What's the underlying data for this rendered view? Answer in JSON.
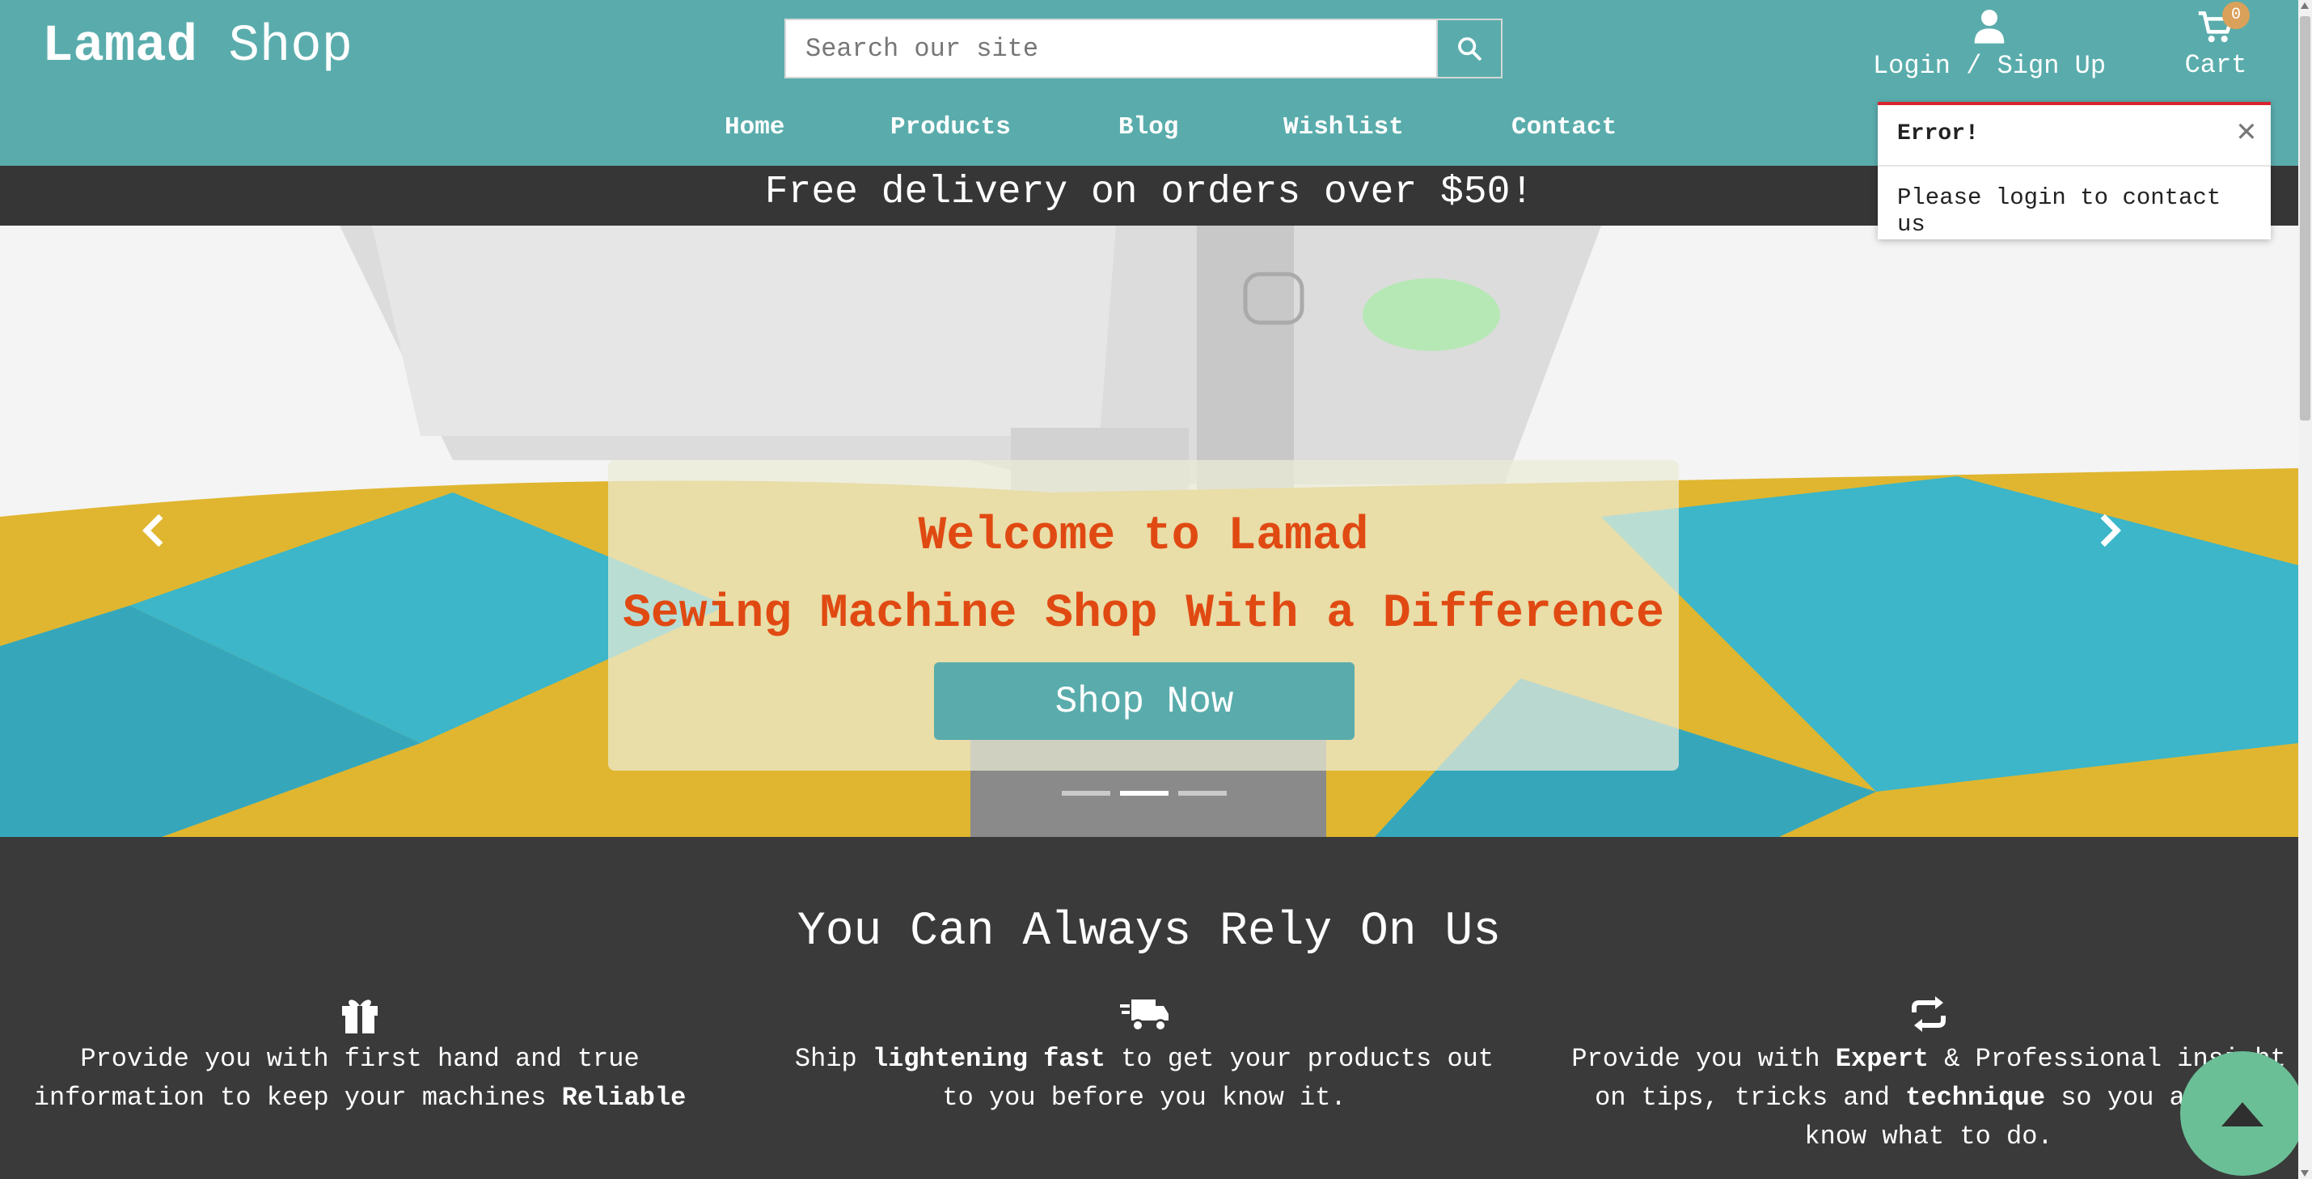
{
  "header": {
    "logo_bold": "Lamad",
    "logo_light": "Shop",
    "search_placeholder": "Search our site",
    "account_label": "Login / Sign Up",
    "cart_label": "Cart",
    "cart_count": "0"
  },
  "nav": {
    "items": [
      {
        "label": "Home"
      },
      {
        "label": "Products"
      },
      {
        "label": "Blog"
      },
      {
        "label": "Wishlist"
      },
      {
        "label": "Contact"
      }
    ]
  },
  "promo": "Free delivery on orders over $50!",
  "hero": {
    "title": "Welcome to Lamad",
    "subtitle": "Sewing Machine Shop With a Difference",
    "button": "Shop Now",
    "active_slide": 2,
    "slide_count": 3
  },
  "toast": {
    "title": "Error!",
    "message": "Please login to contact us"
  },
  "section": {
    "title": "You Can Always Rely On Us",
    "features": [
      {
        "icon": "gift-icon",
        "line1": "Provide you with first hand and true",
        "line2_pre": "information to keep your machines ",
        "line2_bold": "Reliable"
      },
      {
        "icon": "truck-fast-icon",
        "line1_pre": "Ship ",
        "line1_bold": "lightening fast",
        "line1_post": " to get your products out",
        "line2": "to you before you know it."
      },
      {
        "icon": "repeat-icon",
        "line1_pre": "Provide you with ",
        "line1_bold": "Expert",
        "line1_post": " & Professional insight",
        "line2_pre": "on tips, tricks and ",
        "line2_bold": "technique",
        "line2_post": " so you always",
        "line3": "know what to do."
      }
    ]
  },
  "colors": {
    "brand_teal": "#5aacac",
    "headline_orange": "#e04a12",
    "dark_band": "#3a3a3a",
    "error_red": "#d9232e",
    "back_to_top": "#6bbf97"
  }
}
